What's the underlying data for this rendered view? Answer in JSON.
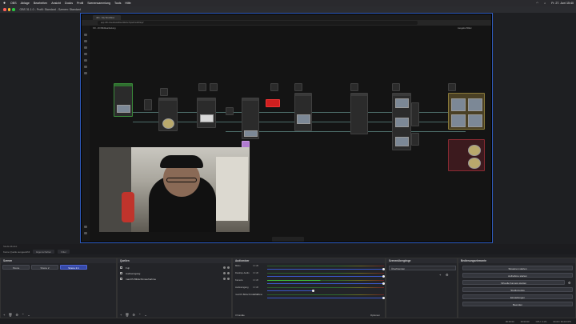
{
  "menubar": {
    "apple": "",
    "items": [
      "OBS",
      "Ablage",
      "Bearbeiten",
      "Ansicht",
      "Docks",
      "Profil",
      "Szenensammlung",
      "Tools",
      "Hilfe"
    ],
    "clock": "Fr. 27. Juni 15:40"
  },
  "window": {
    "title": "OBS 31.1.0 - Profil: Standard - Szenen: Standard"
  },
  "preview": {
    "browser_tab": "n8n - My Workflow",
    "url": "app.n8n.cloud/workflow/0HOeTqGdXo4ZXkqV",
    "canvas_top_left": "Kfz - ZO Bildbearbeitung",
    "canvas_top_right": "Ausgabe Bilder"
  },
  "underbar": {
    "left": "Studio-Modus",
    "tabs": [
      "Szene",
      "Szene"
    ]
  },
  "sourcesbar": {
    "status": "Keine Quelle ausgewählt",
    "props_label": "Eigenschaften",
    "filters_label": "Filter"
  },
  "scenes": {
    "title": "Szenen",
    "items": [
      "Szene",
      "Szene 2",
      "Szene 2.1"
    ],
    "active_index": 2
  },
  "sources": {
    "title": "Quellen",
    "items": [
      "Fuji",
      "Audioeingang",
      "macOS Bildschirmaufnahme"
    ]
  },
  "mixer": {
    "title": "Audiomixer",
    "channels": [
      {
        "name": "Mikro",
        "value": "0.0 dB"
      },
      {
        "name": "Desktop-Audio",
        "value": "0.0 dB"
      },
      {
        "name": "Kamera",
        "value": "0.0 dB"
      },
      {
        "name": "Audioeingang",
        "value": "0.0 dB"
      },
      {
        "name": "macOS Bildschirmaufnahme",
        "value": "0.0 dB"
      }
    ],
    "footer_left": "3 Kanäle",
    "footer_right": "Optionen"
  },
  "transitions": {
    "title": "Szenenübergänge",
    "selected": "Überblenden"
  },
  "controls": {
    "title": "Bedienungselemente",
    "buttons": [
      "Streamen starten",
      "Aufnahme starten",
      "Virtuelle Kamera starten",
      "Studiomodus",
      "Einstellungen",
      "Beenden"
    ]
  },
  "statusbar": {
    "items": [
      "00:00:00",
      "00:00:00",
      "CPU: 3.1%",
      "60.00 / 60.00 FPS"
    ]
  },
  "colors": {
    "accent": "#3649a8",
    "preview_border": "#2f5bbf",
    "panel_bg": "#232428"
  }
}
